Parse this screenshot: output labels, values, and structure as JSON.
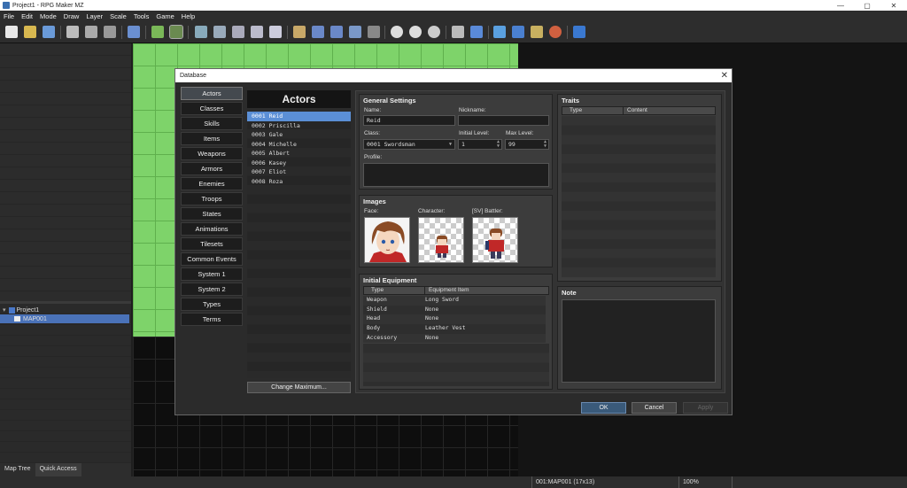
{
  "window": {
    "title": "Project1 - RPG Maker MZ",
    "controls": [
      "—",
      "▢",
      "✕"
    ]
  },
  "menu": [
    "File",
    "Edit",
    "Mode",
    "Draw",
    "Layer",
    "Scale",
    "Tools",
    "Game",
    "Help"
  ],
  "map_tree": {
    "project": "Project1",
    "map": "MAP001"
  },
  "left_tabs": [
    "Map Tree",
    "Quick Access"
  ],
  "status": {
    "map": "001:MAP001 (17x13)",
    "zoom": "100%"
  },
  "dialog": {
    "title": "Database",
    "categories": [
      "Actors",
      "Classes",
      "Skills",
      "Items",
      "Weapons",
      "Armors",
      "Enemies",
      "Troops",
      "States",
      "Animations",
      "Tilesets",
      "Common Events",
      "System 1",
      "System 2",
      "Types",
      "Terms"
    ],
    "list_title": "Actors",
    "actors": [
      "0001 Reid",
      "0002 Priscilla",
      "0003 Gale",
      "0004 Michelle",
      "0005 Albert",
      "0006 Kasey",
      "0007 Eliot",
      "0008 Roza"
    ],
    "change_max": "Change Maximum...",
    "general": {
      "title": "General Settings",
      "name_label": "Name:",
      "name": "Reid",
      "nickname_label": "Nickname:",
      "nickname": "",
      "class_label": "Class:",
      "class": "0001 Swordsman",
      "initial_level_label": "Initial Level:",
      "initial_level": "1",
      "max_level_label": "Max Level:",
      "max_level": "99",
      "profile_label": "Profile:",
      "profile": ""
    },
    "images": {
      "title": "Images",
      "face_label": "Face:",
      "character_label": "Character:",
      "battler_label": "[SV] Battler:"
    },
    "equipment": {
      "title": "Initial Equipment",
      "headers": [
        "Type",
        "Equipment Item"
      ],
      "rows": [
        [
          "Weapon",
          "Long Sword"
        ],
        [
          "Shield",
          "None"
        ],
        [
          "Head",
          "None"
        ],
        [
          "Body",
          "Leather Vest"
        ],
        [
          "Accessory",
          "None"
        ]
      ]
    },
    "traits": {
      "title": "Traits",
      "headers": [
        "Type",
        "Content"
      ]
    },
    "note": {
      "title": "Note"
    },
    "buttons": {
      "ok": "OK",
      "cancel": "Cancel",
      "apply": "Apply"
    }
  }
}
